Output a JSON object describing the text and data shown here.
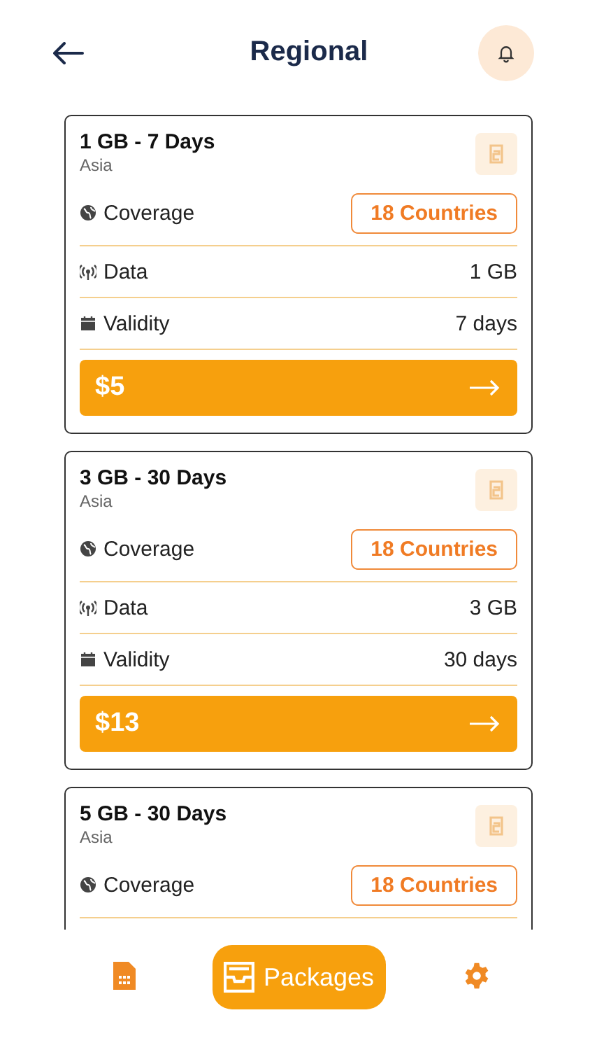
{
  "header": {
    "title": "Regional"
  },
  "plans": [
    {
      "name": "1 GB - 7 Days",
      "region": "Asia",
      "coverage_label": "Coverage",
      "coverage_value": "18 Countries",
      "data_label": "Data",
      "data_value": "1 GB",
      "validity_label": "Validity",
      "validity_value": "7 days",
      "price": "$5"
    },
    {
      "name": "3 GB - 30 Days",
      "region": "Asia",
      "coverage_label": "Coverage",
      "coverage_value": "18 Countries",
      "data_label": "Data",
      "data_value": "3 GB",
      "validity_label": "Validity",
      "validity_value": "30 days",
      "price": "$13"
    },
    {
      "name": "5 GB - 30 Days",
      "region": "Asia",
      "coverage_label": "Coverage",
      "coverage_value": "18 Countries"
    }
  ],
  "nav": [
    {
      "kind": "sim",
      "selected": false
    },
    {
      "kind": "packages",
      "label": "Packages",
      "selected": true
    },
    {
      "kind": "settings",
      "selected": false
    }
  ]
}
